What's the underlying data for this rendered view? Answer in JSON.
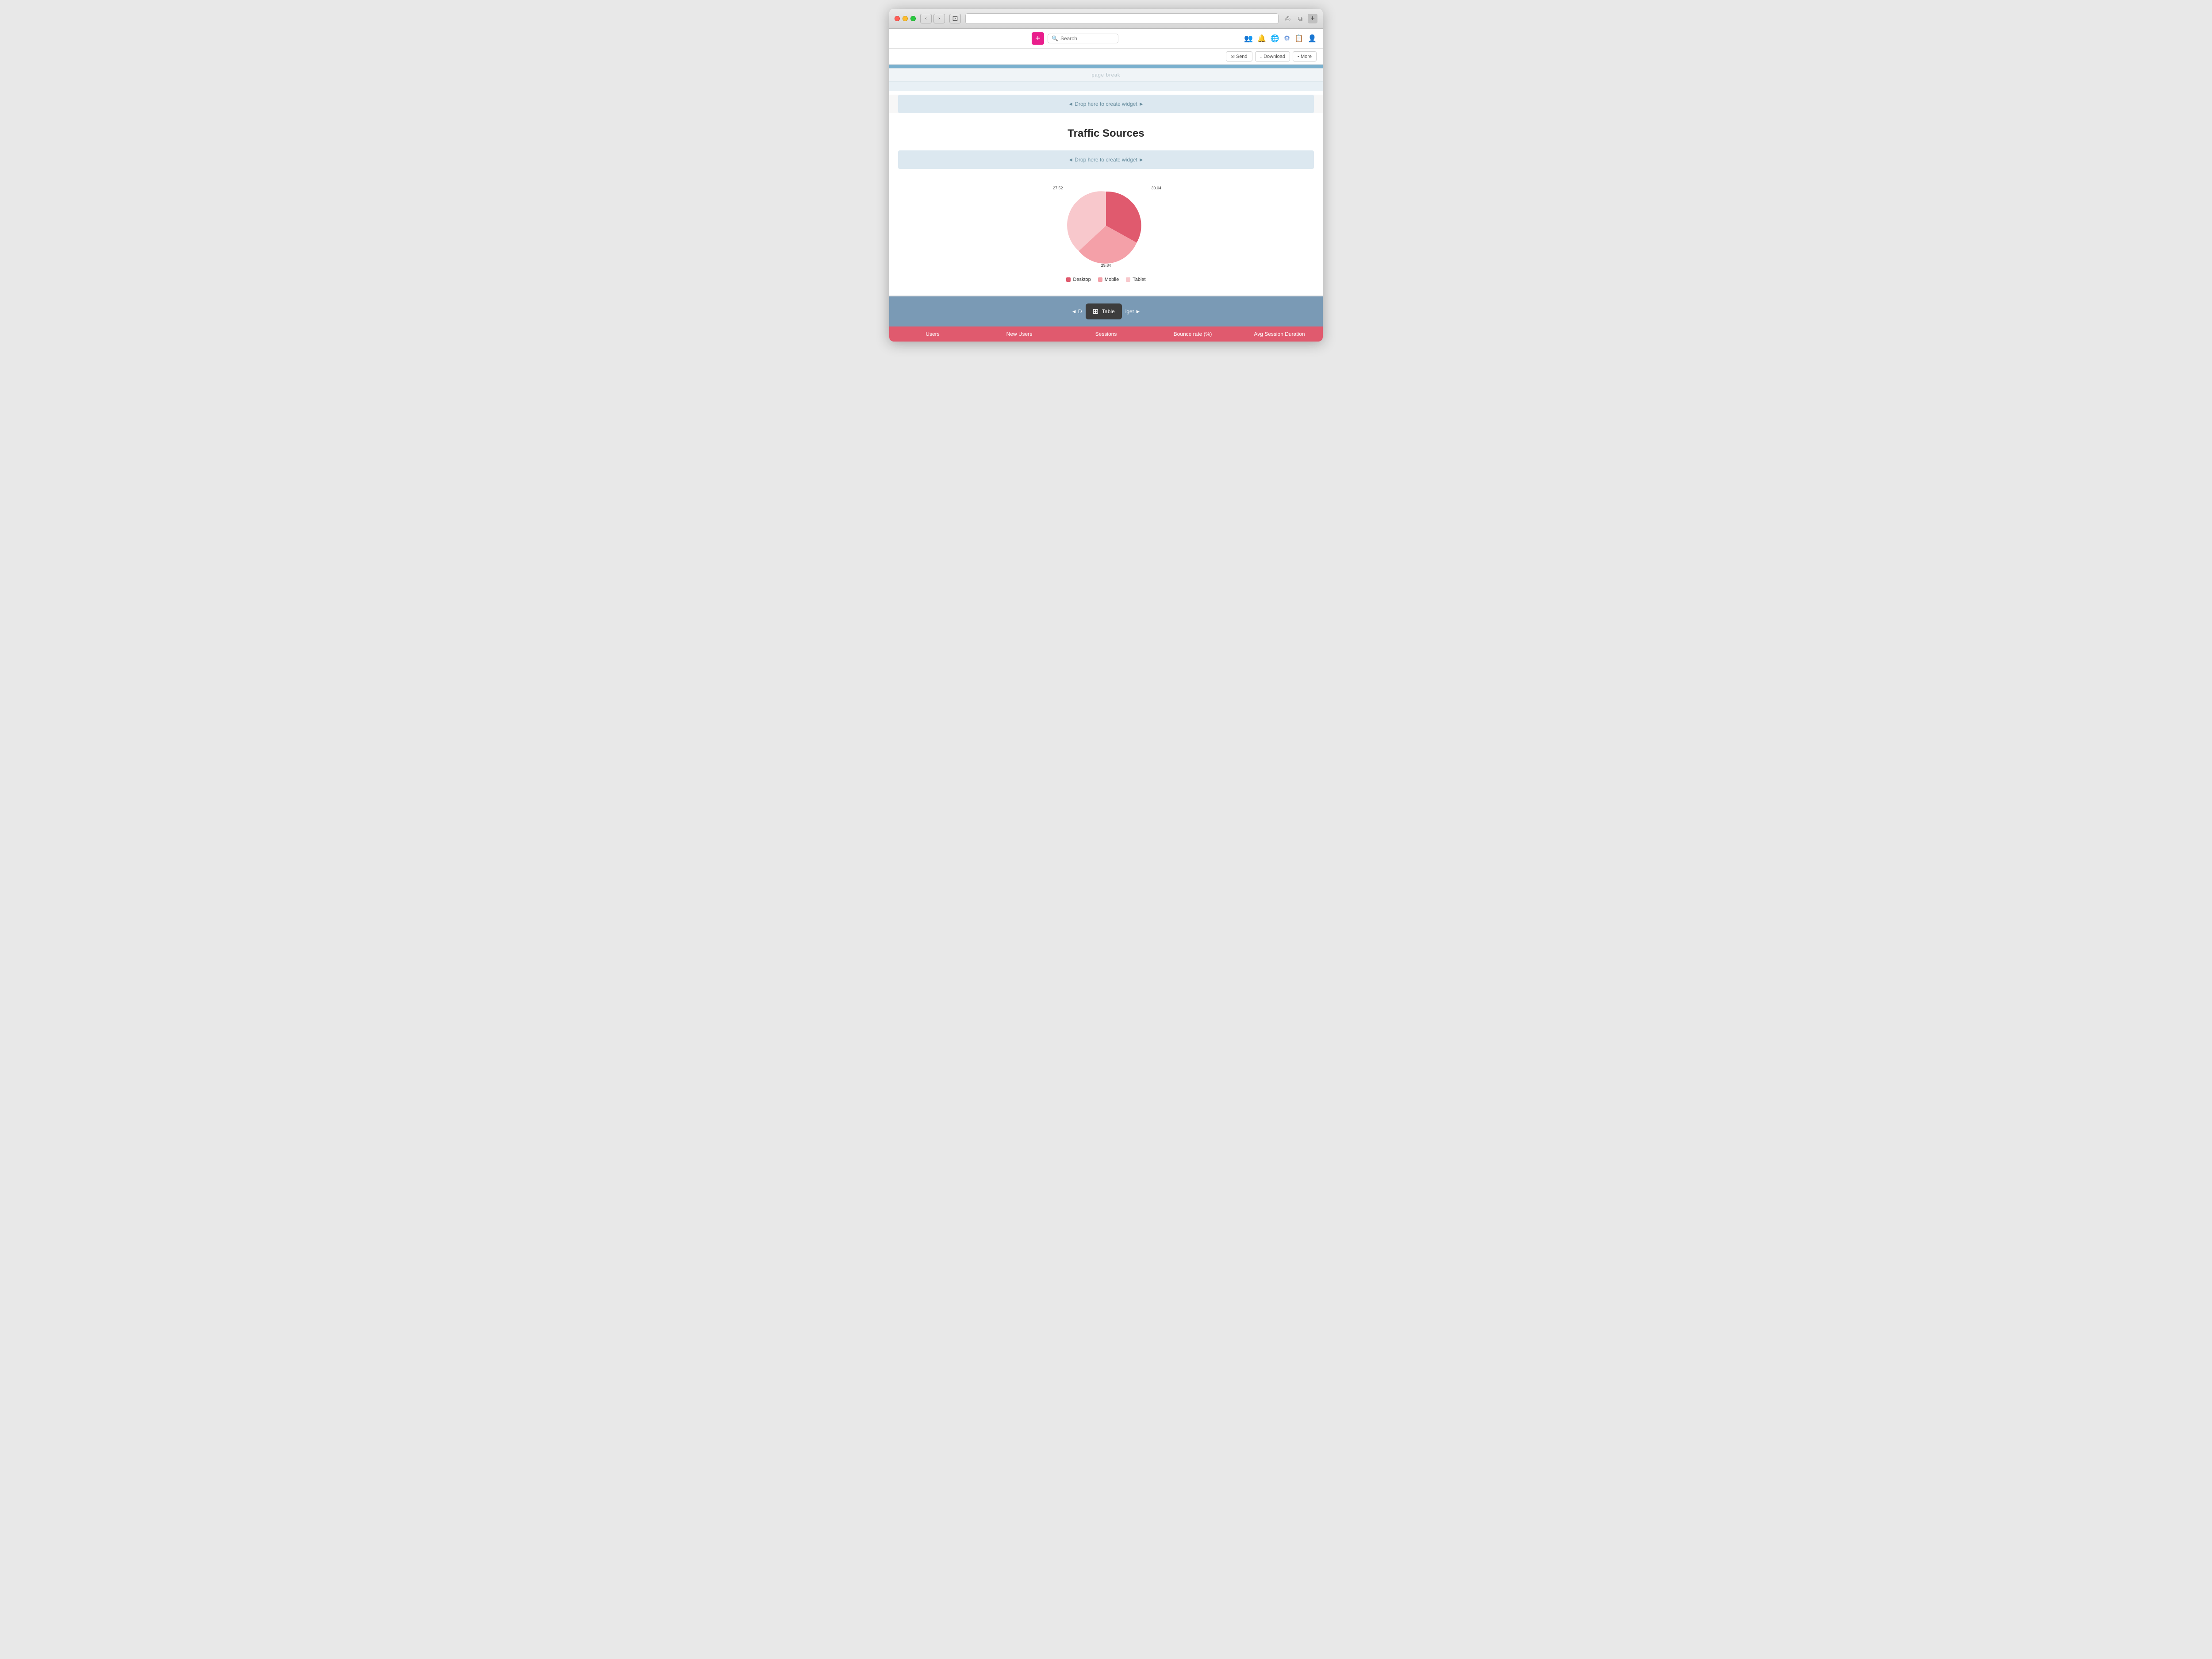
{
  "browser": {
    "traffic_lights": {
      "red": "red",
      "yellow": "yellow",
      "green": "green"
    },
    "nav": {
      "back": "‹",
      "forward": "›",
      "sidebar": "⊡"
    },
    "address": "",
    "add_tab": "+"
  },
  "toolbar": {
    "add_label": "+",
    "search_placeholder": "Search",
    "icons": [
      "👤👤",
      "🔔",
      "🌐",
      "⚙",
      "📋",
      "👤"
    ]
  },
  "action_buttons": {
    "send_label": "✉ Send",
    "download_label": "↓ Download",
    "more_label": "• More"
  },
  "page": {
    "page_break_text": "page break",
    "drop_zone_text": "◄ Drop here to create widget ►",
    "heading": "Traffic Sources",
    "chart": {
      "segments": [
        {
          "label": "Desktop",
          "value": 30.04,
          "color": "#e05a6e",
          "start": 0,
          "end": 30.04
        },
        {
          "label": "Mobile",
          "value": 29.84,
          "color": "#f4a0a8",
          "start": 30.04,
          "end": 59.88
        },
        {
          "label": "Tablet",
          "value": 27.52,
          "color": "#f8c8cc",
          "start": 59.88,
          "end": 87.4
        }
      ],
      "label_desktop": "30.04",
      "label_mobile": "29.84",
      "label_tablet": "27.52"
    },
    "legend": [
      {
        "name": "Desktop",
        "color": "#e05a6e"
      },
      {
        "name": "Mobile",
        "color": "#f4a0a8"
      },
      {
        "name": "Tablet",
        "color": "#f8c8cc"
      }
    ],
    "table_widget": {
      "drop_left": "◄ D",
      "icon": "⊞",
      "label": "Table",
      "drop_right": "iget ►"
    },
    "data_table": {
      "columns": [
        "Users",
        "New Users",
        "Sessions",
        "Bounce rate (%)",
        "Avg Session Duration"
      ]
    }
  }
}
